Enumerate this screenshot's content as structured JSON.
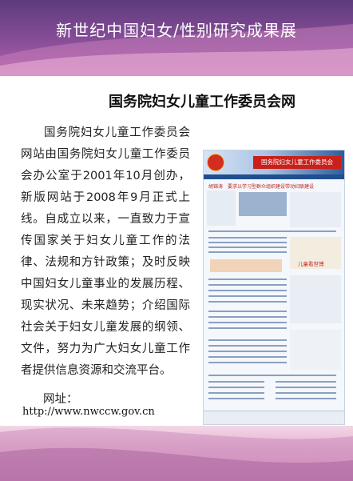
{
  "header": {
    "title": "新世纪中国妇女/性别研究成果展"
  },
  "site": {
    "name": "国务院妇女儿童工作委员会网",
    "description": "国务院妇女儿童工作委员会网站由国务院妇女儿童工作委员会办公室于2001年10月创办，新版网站于2008年9月正式上线。自成立以来，一直致力于宣传国家关于妇女儿童工作的法律、法规和方针政策；及时反映中国妇女儿童事业的发展历程、现实状况、未来趋势；介绍国际社会关于妇女儿童发展的纲领、文件，努力为广大妇女儿童工作者提供信息资源和交流平台。",
    "url_label": "网址：",
    "url": "http://www.nwccw.gov.cn"
  },
  "screenshot": {
    "logo_text": "国务院妇女儿童工作委员会",
    "headline": "胡锦涛　要求以学习型群众组织建设带动妇联建设",
    "promo": "儿童看世博"
  },
  "colors": {
    "header_purple": "#5d3b7c",
    "accent_pink": "#d98cc4",
    "logo_red": "#c9201a",
    "nav_blue": "#1f4f8f"
  }
}
